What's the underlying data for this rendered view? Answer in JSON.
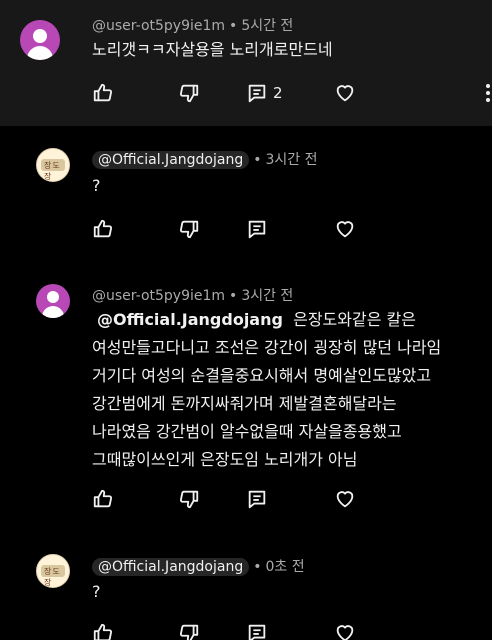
{
  "comments": [
    {
      "author": "@user-ot5py9ie1m",
      "time": "5시간 전",
      "lines": [
        "노리갯ㅋㅋ자살용을 노리개로만드네"
      ],
      "reply_count": "2"
    },
    {
      "author": "@Official.Jangdojang",
      "time": "3시간 전",
      "lines": [
        "?"
      ]
    },
    {
      "author": "@user-ot5py9ie1m",
      "time": "3시간 전",
      "mention": "@Official.Jangdojang",
      "lines": [
        "은장도와같은 칼은",
        "여성만들고다니고 조선은 강간이 굉장히 많던 나라임",
        "거기다 여성의 순결을중요시해서 명예살인도많았고",
        "강간범에게 돈까지싸줘가며 제발결혼해달라는",
        "나라였음  강간범이 알수없을때 자살을종용했고",
        "그때많이쓰인게 은장도임 노리개가 아님"
      ]
    },
    {
      "author": "@Official.Jangdojang",
      "time": "0초 전",
      "lines": [
        "?"
      ]
    }
  ],
  "avatar_stamp_text": "장도장",
  "icons": [
    "like-icon",
    "dislike-icon",
    "reply-icon",
    "heart-icon",
    "more-vert-icon"
  ],
  "colors": {
    "background": "#000000",
    "highlight_background": "#181818",
    "avatar_default": "#b848b6",
    "meta_text": "#aaaaaa"
  }
}
